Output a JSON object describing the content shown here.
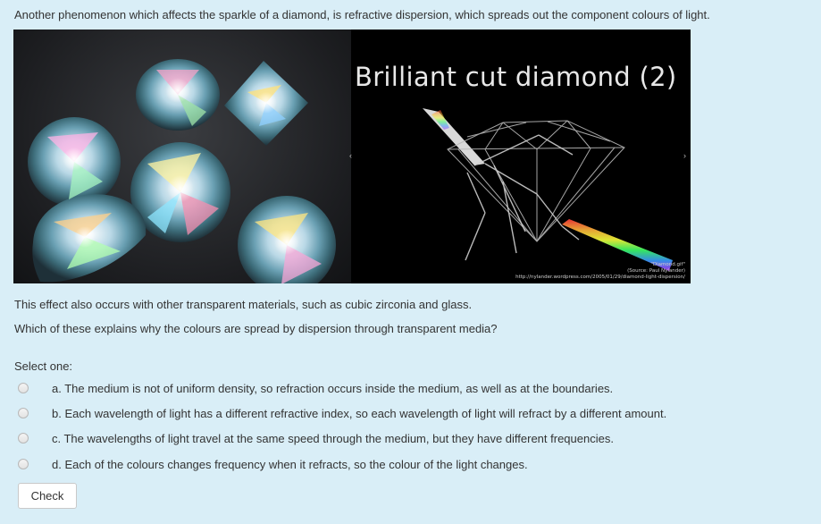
{
  "question": {
    "intro": "Another phenomenon which affects the sparkle of a diamond, is refractive dispersion, which spreads out the component colours of light.",
    "slide": {
      "title": "Brilliant cut diamond (2)",
      "caption_line1": "\"Diamond.gif\"",
      "caption_line2": "(Source: Paul Nylander)",
      "caption_line3": "http://nylander.wordpress.com/2005/01/29/diamond-light-dispersion/",
      "prev_glyph": "‹",
      "next_glyph": "›"
    },
    "para1": "This effect also occurs with other transparent materials, such as cubic zirconia and glass.",
    "para2": "Which of these explains why the colours are spread by dispersion through transparent media?",
    "select_label": "Select one:",
    "options": [
      "a. The medium is not of uniform density, so refraction occurs inside the medium, as well as at the boundaries.",
      "b. Each wavelength of light has a different refractive index, so each wavelength of light will refract by a different amount.",
      "c. The wavelengths of light travel at the same speed through the medium, but they have different frequencies.",
      "d. Each of the colours changes frequency when it refracts, so the colour of the light changes."
    ],
    "check_label": "Check"
  }
}
